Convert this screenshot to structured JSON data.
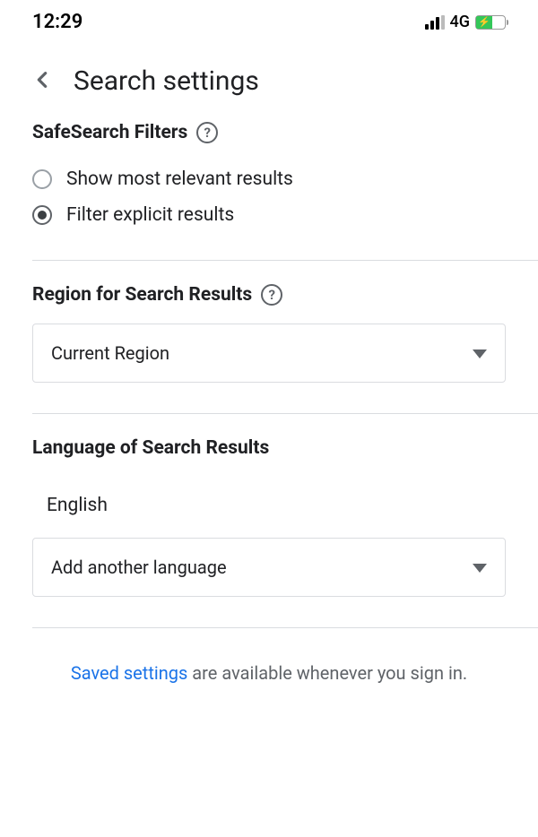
{
  "status": {
    "time": "12:29",
    "network": "4G"
  },
  "header": {
    "title": "Search settings"
  },
  "safesearch": {
    "title": "SafeSearch Filters",
    "options": {
      "relevant": "Show most relevant results",
      "filter": "Filter explicit results"
    }
  },
  "region": {
    "title": "Region for Search Results",
    "selected": "Current Region"
  },
  "language": {
    "title": "Language of Search Results",
    "current": "English",
    "add_label": "Add another language"
  },
  "footer": {
    "link": "Saved settings",
    "rest": " are available whenever you sign in."
  }
}
